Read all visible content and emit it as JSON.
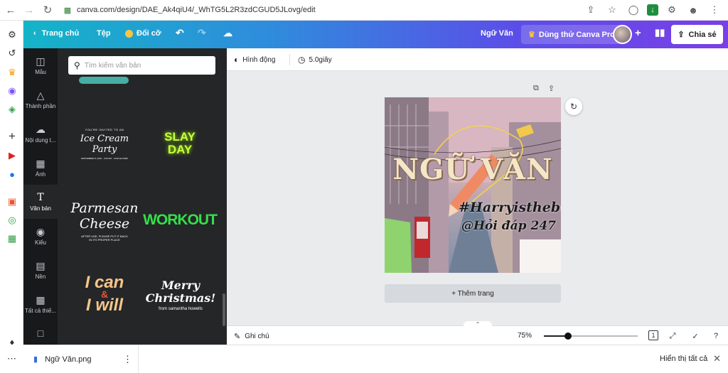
{
  "browser": {
    "url": "canva.com/design/DAE_Ak4qiU4/_WhTG5L2R3zdCGUD5JLovg/edit"
  },
  "topbar": {
    "home": "Trang chủ",
    "file": "Tệp",
    "resize": "Đổi cỡ",
    "doc_title": "Ngữ Văn",
    "pro": "Dùng thử Canva Pro",
    "share": "Chia sẻ"
  },
  "rail": [
    {
      "label": "Mẫu",
      "icon": "layout-icon"
    },
    {
      "label": "Thành phần",
      "icon": "shapes-icon"
    },
    {
      "label": "Nội dung t...",
      "icon": "upload-cloud-icon"
    },
    {
      "label": "Ảnh",
      "icon": "image-icon"
    },
    {
      "label": "Văn bản",
      "icon": "text-icon"
    },
    {
      "label": "Kiểu",
      "icon": "palette-icon"
    },
    {
      "label": "Nền",
      "icon": "background-icon"
    },
    {
      "label": "Tất cả thiế...",
      "icon": "grid-icon"
    }
  ],
  "panel": {
    "search_placeholder": "Tìm kiếm văn bản",
    "templates": [
      {
        "line1": "YOU'RE INVITED TO AN",
        "line2": "Ice Cream Party",
        "line3": "SEPTEMBER 8, 2023 · 2:00 PM · CASTLE PARK"
      },
      {
        "line1": "SLAY",
        "line2": "DAY"
      },
      {
        "line1": "Parmesan",
        "line2": "Cheese",
        "line3": "AFTER USE, PLEASE PUT IT BACK IN ITS PROPER PLACE"
      },
      {
        "line1": "WORKOUT"
      },
      {
        "line1": "I can",
        "line2": "&",
        "line3": "I will"
      },
      {
        "line1": "Merry",
        "line2": "Christmas!",
        "line3": "from samantha howells"
      }
    ]
  },
  "toolbar": {
    "animate": "Hình động",
    "duration": "5.0giây"
  },
  "design": {
    "title": "NGỮ VĂN",
    "hashtag": "#Harryisthebest",
    "handle": "@Hỏi đáp 247"
  },
  "add_page": "+ Thêm trang",
  "bottom": {
    "notes": "Ghi chú",
    "zoom": "75%",
    "page": "1",
    "zoom_fraction": 0.26
  },
  "download": {
    "file": "Ngữ Văn.png",
    "show_all": "Hiển thị tất cả"
  },
  "colors": {
    "topbar_start": "#14b4c8",
    "topbar_end": "#7a3fe6",
    "panel_bg": "#252627",
    "rail_bg": "#18191b",
    "workout_green": "#33e04a",
    "slay_green": "#c7ff3d"
  }
}
